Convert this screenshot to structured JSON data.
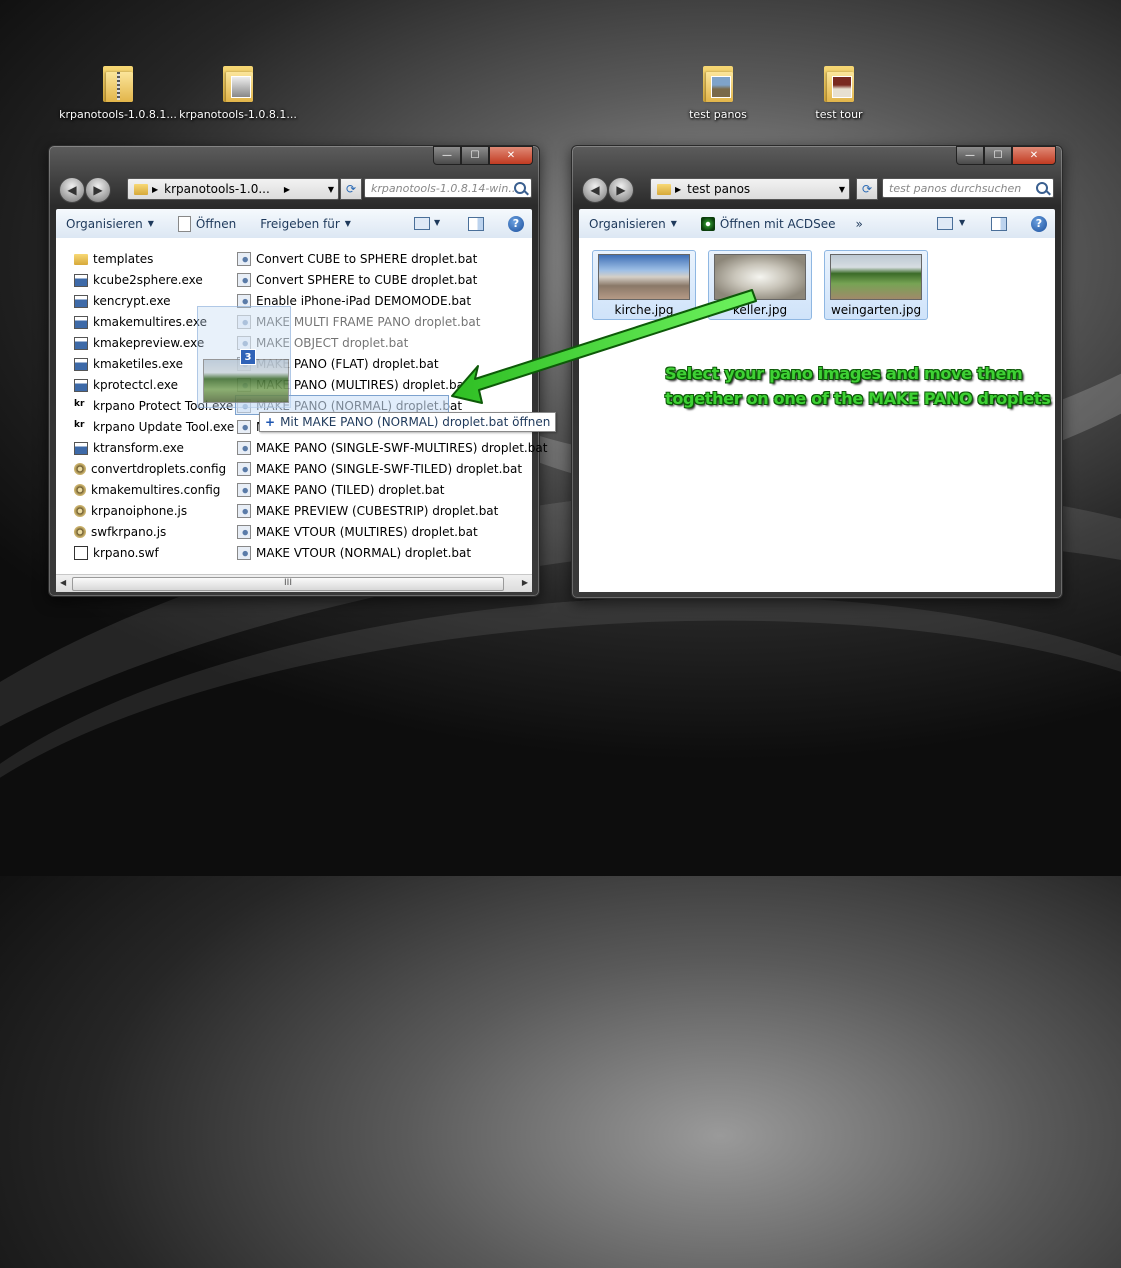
{
  "desktop": {
    "icons": [
      {
        "label": "krpanotools-1.0.8.1..."
      },
      {
        "label": "krpanotools-1.0.8.1..."
      },
      {
        "label": "test panos"
      },
      {
        "label": "test tour"
      }
    ]
  },
  "left_window": {
    "address": "krpanotools-1.0...",
    "search_placeholder": "krpanotools-1.0.8.14-win...",
    "toolbar": {
      "organize": "Organisieren",
      "open": "Öffnen",
      "share": "Freigeben für"
    },
    "files_col1": [
      {
        "name": "templates",
        "icon": "folder"
      },
      {
        "name": "kcube2sphere.exe",
        "icon": "exe"
      },
      {
        "name": "kencrypt.exe",
        "icon": "exe"
      },
      {
        "name": "kmakemultires.exe",
        "icon": "exe"
      },
      {
        "name": "kmakepreview.exe",
        "icon": "exe"
      },
      {
        "name": "kmaketiles.exe",
        "icon": "exe"
      },
      {
        "name": "kprotectcl.exe",
        "icon": "exe"
      },
      {
        "name": "krpano Protect Tool.exe",
        "icon": "krpano"
      },
      {
        "name": "krpano Update Tool.exe",
        "icon": "krpano"
      },
      {
        "name": "ktransform.exe",
        "icon": "exe"
      },
      {
        "name": "convertdroplets.config",
        "icon": "config"
      },
      {
        "name": "kmakemultires.config",
        "icon": "config"
      },
      {
        "name": "krpanoiphone.js",
        "icon": "config"
      },
      {
        "name": "swfkrpano.js",
        "icon": "config"
      },
      {
        "name": "krpano.swf",
        "icon": "swf"
      }
    ],
    "files_col2": [
      {
        "name": "Convert CUBE to SPHERE droplet.bat"
      },
      {
        "name": "Convert SPHERE to CUBE droplet.bat"
      },
      {
        "name": "Enable iPhone-iPad DEMOMODE.bat"
      },
      {
        "name": "MAKE MULTI FRAME PANO droplet.bat"
      },
      {
        "name": "MAKE OBJECT droplet.bat"
      },
      {
        "name": "MAKE PANO (FLAT) droplet.bat"
      },
      {
        "name": "MAKE PANO (MULTIRES) droplet.bat"
      },
      {
        "name": "MAKE PANO (NORMAL) droplet.bat"
      },
      {
        "name": "M"
      },
      {
        "name": "MAKE PANO (SINGLE-SWF-MULTIRES) droplet.bat"
      },
      {
        "name": "MAKE PANO (SINGLE-SWF-TILED) droplet.bat"
      },
      {
        "name": "MAKE PANO (TILED) droplet.bat"
      },
      {
        "name": "MAKE PREVIEW (CUBESTRIP) droplet.bat"
      },
      {
        "name": "MAKE VTOUR (MULTIRES) droplet.bat"
      },
      {
        "name": "MAKE VTOUR (NORMAL) droplet.bat"
      }
    ],
    "scroll_grip": "III"
  },
  "right_window": {
    "address": "test panos",
    "search_placeholder": "test panos durchsuchen",
    "toolbar": {
      "organize": "Organisieren",
      "open_with": "Öffnen mit ACDSee",
      "more": "»"
    },
    "thumbnails": [
      {
        "name": "kirche.jpg"
      },
      {
        "name": "keller.jpg"
      },
      {
        "name": "weingarten.jpg"
      }
    ]
  },
  "drag": {
    "count": "3",
    "tooltip": "Mit MAKE PANO (NORMAL) droplet.bat öffnen",
    "plus": "+"
  },
  "annotation": {
    "text": "Select your pano images and move them together on one of the MAKE PANO droplets",
    "color": "#3ed134"
  },
  "caption_buttons": {
    "min": "—",
    "max": "☐",
    "close": "✕"
  }
}
